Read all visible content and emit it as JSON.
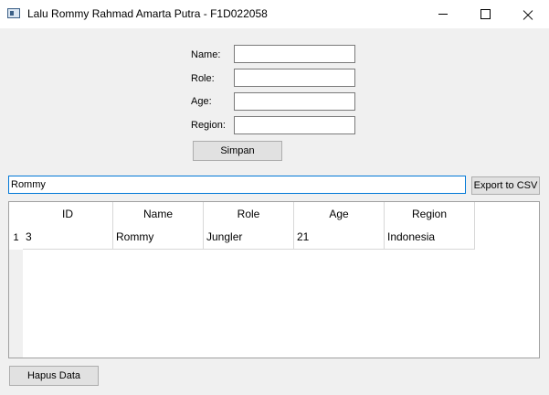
{
  "window": {
    "title": "Lalu Rommy Rahmad Amarta Putra - F1D022058"
  },
  "form": {
    "name_label": "Name:",
    "role_label": "Role:",
    "age_label": "Age:",
    "region_label": "Region:",
    "name_value": "",
    "role_value": "",
    "age_value": "",
    "region_value": "",
    "save_label": "Simpan"
  },
  "search": {
    "value": "Rommy"
  },
  "export_label": "Export to CSV",
  "table": {
    "headers": [
      "ID",
      "Name",
      "Role",
      "Age",
      "Region"
    ],
    "rows": [
      {
        "num": "1",
        "cells": [
          "3",
          "Rommy",
          "Jungler",
          "21",
          "Indonesia"
        ]
      }
    ]
  },
  "delete_label": "Hapus Data"
}
